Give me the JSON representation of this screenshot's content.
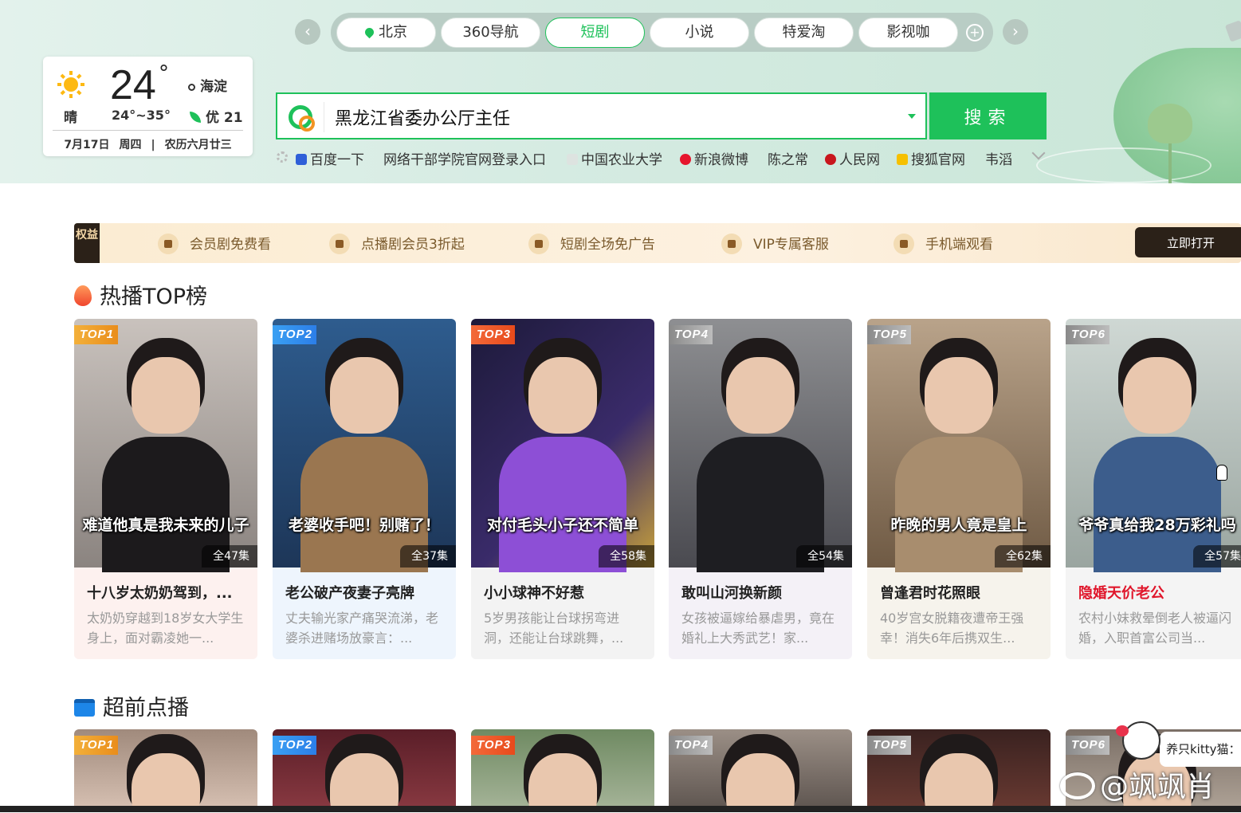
{
  "nav": {
    "tabs": [
      {
        "label": "北京",
        "active": false
      },
      {
        "label": "360导航",
        "active": false
      },
      {
        "label": "短剧",
        "active": true
      },
      {
        "label": "小说",
        "active": false
      },
      {
        "label": "特爱淘",
        "active": false
      },
      {
        "label": "影视咖",
        "active": false
      }
    ],
    "prev_icon": "chevron-left-icon",
    "next_icon": "chevron-right-icon",
    "add_icon": "plus-circle-icon",
    "accent_color": "#1ec15a"
  },
  "weather": {
    "temp": "24",
    "degree": "°",
    "condition": "晴",
    "range": "24°~35°",
    "location": "海淀",
    "aqi": "优 21",
    "date": "7月17日",
    "weekday": "周四",
    "sep": "|",
    "lunar": "农历六月廿三",
    "icon": "sun-icon"
  },
  "search": {
    "query": "黑龙江省委办公厅主任",
    "button": "搜索",
    "logo": "360-search-logo",
    "dropdown_icon": "caret-down-icon"
  },
  "quick_links": [
    "百度一下",
    "网络干部学院官网登录入口",
    "中国农业大学",
    "新浪微博",
    "陈之常",
    "人民网",
    "搜狐官网",
    "韦滔"
  ],
  "benefits": {
    "tag": "权益",
    "items": [
      "会员剧免费看",
      "点播剧会员3折起",
      "短剧全场免广告",
      "VIP专属客服",
      "手机端观看"
    ],
    "button": "立即打开",
    "colors": {
      "bar": "#fbecd2",
      "text": "#7a5a2c",
      "button": "#2b2118"
    }
  },
  "hot": {
    "title": "热播TOP榜",
    "cards": [
      {
        "rank": "TOP1",
        "caption": "难道他真是我未来的儿子",
        "episodes": "全47集",
        "title": "十八岁太奶奶驾到，...",
        "desc": "太奶奶穿越到18岁女大学生身上，面对霸凌她一..."
      },
      {
        "rank": "TOP2",
        "caption": "老婆收手吧！别赌了！",
        "episodes": "全37集",
        "title": "老公破产夜妻子亮牌",
        "desc": "丈夫输光家产痛哭流涕，老婆杀进赌场放豪言：..."
      },
      {
        "rank": "TOP3",
        "caption": "对付毛头小子还不简单",
        "episodes": "全58集",
        "title": "小小球神不好惹",
        "desc": "5岁男孩能让台球拐弯进洞，还能让台球跳舞，..."
      },
      {
        "rank": "TOP4",
        "caption": "",
        "episodes": "全54集",
        "title": "敢叫山河换新颜",
        "desc": "女孩被逼嫁给暴虐男，竟在婚礼上大秀武艺！家..."
      },
      {
        "rank": "TOP5",
        "caption": "昨晚的男人竟是皇上",
        "episodes": "全62集",
        "title": "曾逢君时花照眼",
        "desc": "40岁宫女脱籍夜遭帝王强幸！消失6年后携双生..."
      },
      {
        "rank": "TOP6",
        "caption": "爷爷真给我28万彩礼吗",
        "episodes": "全57集",
        "title": "隐婚天价老公",
        "desc": "农村小妹救晕倒老人被逼闪婚，入职首富公司当..."
      }
    ]
  },
  "preview": {
    "title": "超前点播",
    "ranks": [
      "TOP1",
      "TOP2",
      "TOP3",
      "TOP4",
      "TOP5",
      "TOP6"
    ]
  },
  "overlay": {
    "bubble": "养只kitty猫：",
    "watermark": "@飒飒肖"
  }
}
